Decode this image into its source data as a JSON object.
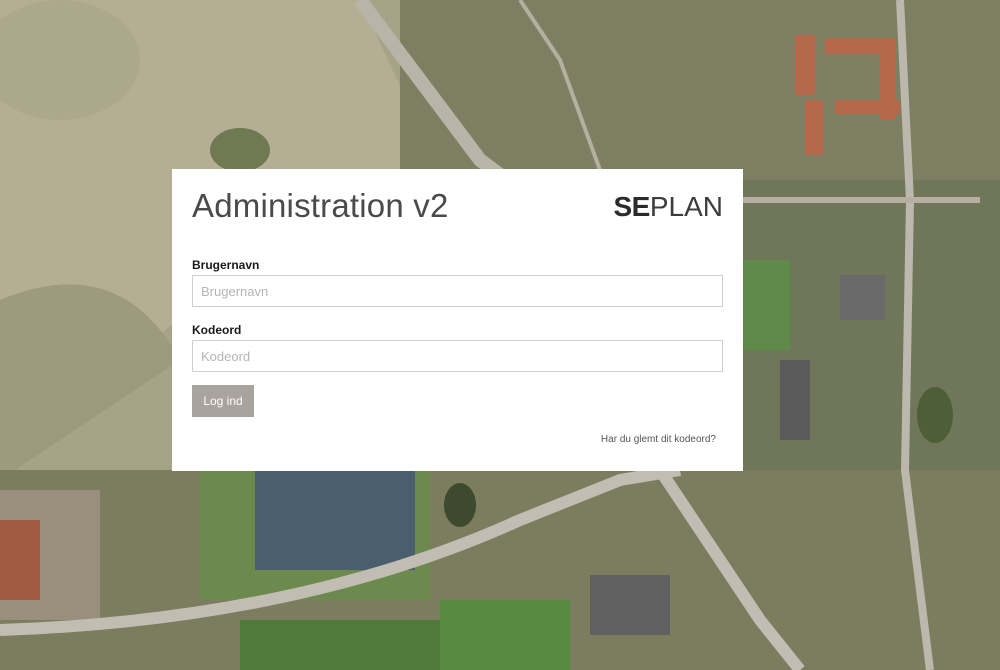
{
  "login": {
    "title": "Administration v2",
    "brand": {
      "bold": "SE",
      "light": "PLAN"
    },
    "username": {
      "label": "Brugernavn",
      "placeholder": "Brugernavn",
      "value": ""
    },
    "password": {
      "label": "Kodeord",
      "placeholder": "Kodeord",
      "value": ""
    },
    "submit_label": "Log ind",
    "forgot_link": "Har du glemt dit kodeord?"
  },
  "colors": {
    "button_bg": "#a9a39d",
    "card_bg": "#ffffff",
    "title_text": "#4a4a4a"
  }
}
